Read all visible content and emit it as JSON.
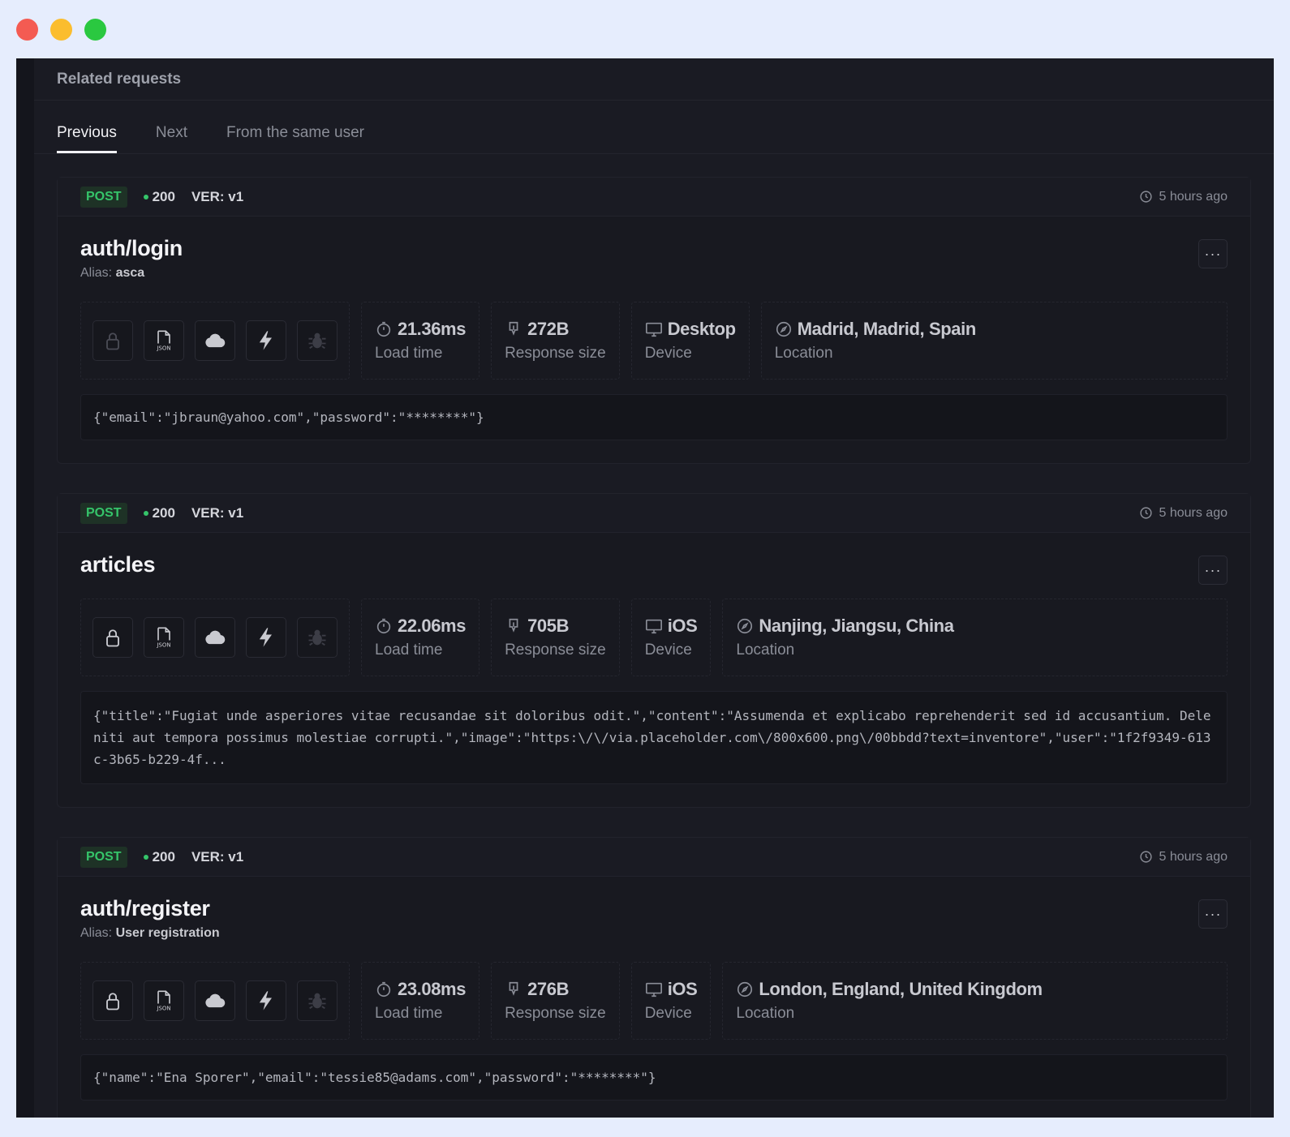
{
  "panel": {
    "title": "Related requests"
  },
  "tabs": [
    {
      "label": "Previous",
      "active": true
    },
    {
      "label": "Next",
      "active": false
    },
    {
      "label": "From the same user",
      "active": false
    }
  ],
  "labels": {
    "alias_prefix": "Alias:",
    "load_time": "Load time",
    "response_size": "Response size",
    "device": "Device",
    "location": "Location",
    "more": "···"
  },
  "colors": {
    "method_green": "#35c46a",
    "background": "#1a1b23"
  },
  "requests": [
    {
      "method": "POST",
      "status": "200",
      "version": "VER: v1",
      "time": "5 hours ago",
      "endpoint": "auth/login",
      "alias": "asca",
      "load_time": "21.36ms",
      "response_size": "272B",
      "device": "Desktop",
      "location": "Madrid, Madrid, Spain",
      "payload": "{\"email\":\"jbraun@yahoo.com\",\"password\":\"********\"}"
    },
    {
      "method": "POST",
      "status": "200",
      "version": "VER: v1",
      "time": "5 hours ago",
      "endpoint": "articles",
      "alias": "",
      "load_time": "22.06ms",
      "response_size": "705B",
      "device": "iOS",
      "location": "Nanjing, Jiangsu, China",
      "payload": "{\"title\":\"Fugiat unde asperiores vitae recusandae sit doloribus odit.\",\"content\":\"Assumenda et explicabo reprehenderit sed id accusantium. Deleniti aut tempora possimus molestiae corrupti.\",\"image\":\"https:\\/\\/via.placeholder.com\\/800x600.png\\/00bbdd?text=inventore\",\"user\":\"1f2f9349-613c-3b65-b229-4f..."
    },
    {
      "method": "POST",
      "status": "200",
      "version": "VER: v1",
      "time": "5 hours ago",
      "endpoint": "auth/register",
      "alias": "User registration",
      "load_time": "23.08ms",
      "response_size": "276B",
      "device": "iOS",
      "location": "London, England, United Kingdom",
      "payload": "{\"name\":\"Ena Sporer\",\"email\":\"tessie85@adams.com\",\"password\":\"********\"}"
    }
  ]
}
